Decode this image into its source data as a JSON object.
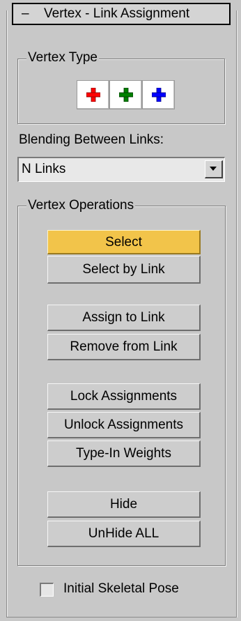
{
  "rollout": {
    "collapse_symbol": "–",
    "title": "Vertex - Link Assignment"
  },
  "vertex_type": {
    "label": "Vertex Type",
    "buttons": [
      {
        "icon": "red-plus-icon",
        "color": "#ff0000"
      },
      {
        "icon": "green-plus-icon",
        "color": "#008000"
      },
      {
        "icon": "blue-plus-icon",
        "color": "#0000ff"
      }
    ]
  },
  "blending": {
    "label": "Blending Between Links:",
    "selected": "N Links"
  },
  "vertex_operations": {
    "label": "Vertex Operations",
    "buttons": [
      {
        "label": "Select",
        "active": true
      },
      {
        "label": "Select by Link",
        "active": false
      },
      {
        "label": "Assign to Link",
        "active": false
      },
      {
        "label": "Remove from Link",
        "active": false
      },
      {
        "label": "Lock Assignments",
        "active": false
      },
      {
        "label": "Unlock Assignments",
        "active": false
      },
      {
        "label": "Type-In Weights",
        "active": false
      },
      {
        "label": "Hide",
        "active": false
      },
      {
        "label": "UnHide ALL",
        "active": false
      }
    ]
  },
  "initial_skeletal_pose": {
    "label": "Initial Skeletal Pose",
    "checked": false
  },
  "colors": {
    "panel_bg": "#c8c8c8",
    "active_button": "#f2c44a"
  }
}
